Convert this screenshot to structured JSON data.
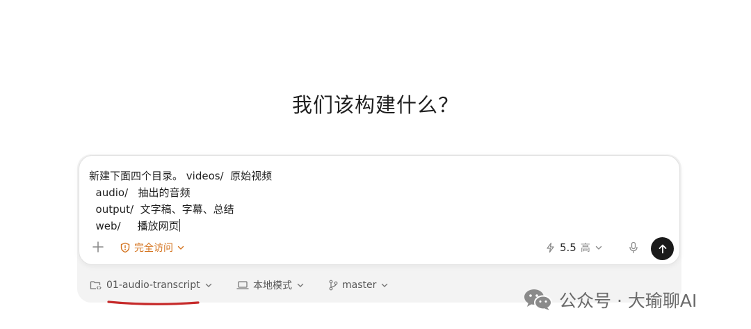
{
  "headline": "我们该构建什么？",
  "composer": {
    "prompt_lines": [
      "新建下面四个目录。 videos/  原始视频",
      "  audio/   抽出的音频",
      "  output/  文字稿、字幕、总结",
      "  web/     播放网页"
    ],
    "access_label": "完全访问",
    "model_version": "5.5",
    "reasoning_level": "高"
  },
  "footer": {
    "project": "01-audio-transcript",
    "mode": "本地模式",
    "branch": "master"
  },
  "watermark": {
    "text": "公众号 · 大瑜聊AI"
  },
  "colors": {
    "accent_orange": "#d4731e",
    "annotation_red": "#c62a2a",
    "send_button": "#1a1a1a"
  },
  "icons": {
    "plus": "plus-icon",
    "access": "warning-shield-icon",
    "model": "lightning-icon",
    "mic": "microphone-icon",
    "send": "arrow-up-icon",
    "project": "folder-code-icon",
    "mode": "laptop-icon",
    "branch": "git-branch-icon",
    "chevron": "chevron-down-icon",
    "watermark": "wechat-icon"
  }
}
